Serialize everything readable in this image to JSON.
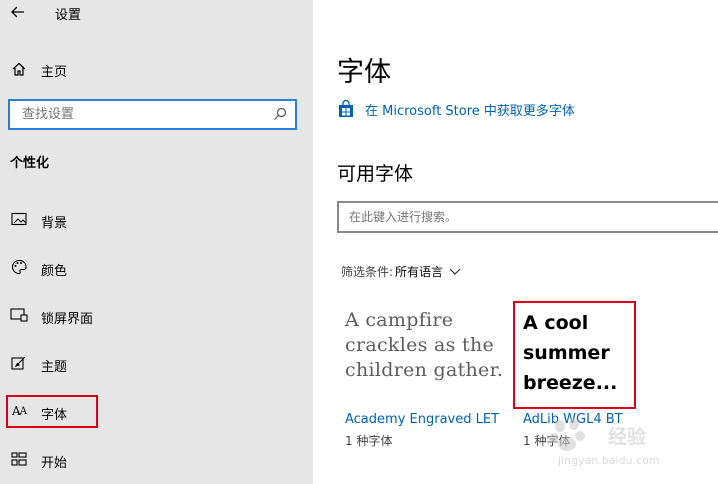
{
  "window": {
    "title": "设置"
  },
  "sidebar": {
    "home_label": "主页",
    "search_placeholder": "查找设置",
    "section_title": "个性化",
    "items": [
      {
        "label": "背景",
        "icon": "picture-icon"
      },
      {
        "label": "颜色",
        "icon": "palette-icon"
      },
      {
        "label": "锁屏界面",
        "icon": "lock-screen-icon"
      },
      {
        "label": "主题",
        "icon": "theme-icon"
      },
      {
        "label": "字体",
        "icon": "font-icon",
        "selected": true
      },
      {
        "label": "开始",
        "icon": "start-icon"
      }
    ]
  },
  "main": {
    "title": "字体",
    "store_link": "在 Microsoft Store 中获取更多字体",
    "available_heading": "可用字体",
    "font_search_placeholder": "在此键入进行搜索。",
    "filter_label": "筛选条件:",
    "filter_value": "所有语言",
    "fonts": [
      {
        "preview": "A campfire crackles as the children gather.",
        "name": "Academy Engraved LET",
        "count": "1 种字体"
      },
      {
        "preview": "A cool summer breeze...",
        "name": "AdLib WGL4 BT",
        "count": "1 种字体"
      }
    ]
  },
  "watermark": {
    "main": "经验",
    "sub": "jingyan.baidu.com"
  },
  "colors": {
    "accent": "#0063b1",
    "highlight": "#d9001b",
    "sidebar_bg": "#e6e6e6",
    "search_border": "#2a7ed3"
  }
}
